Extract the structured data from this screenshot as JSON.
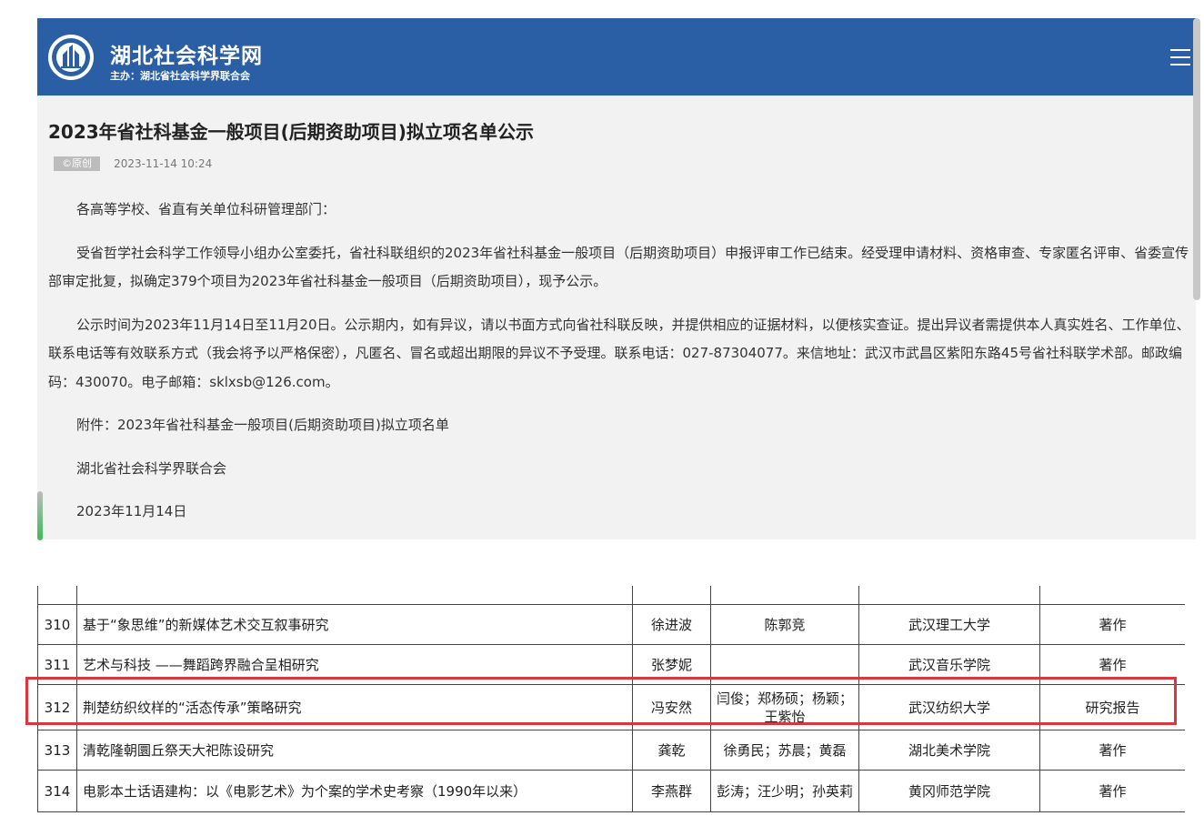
{
  "header": {
    "site_name": "湖北社会科学网",
    "sponsor": "主办：湖北省社会科学界联合会",
    "logo_icon": "emblem-logo-icon",
    "menu_icon": "hamburger-menu-icon",
    "bg_color": "#2a5fa6"
  },
  "article": {
    "title": "2023年省社科基金一般项目(后期资助项目)拟立项名单公示",
    "badge": "©原创",
    "date": "2023-11-14 10:24",
    "paragraphs": [
      "各高等学校、省直有关单位科研管理部门：",
      "受省哲学社会科学工作领导小组办公室委托，省社科联组织的2023年省社科基金一般项目（后期资助项目）申报评审工作已结束。经受理申请材料、资格审查、专家匿名评审、省委宣传部审定批复，拟确定379个项目为2023年省社科基金一般项目（后期资助项目），现予公示。",
      "公示时间为2023年11月14日至11月20日。公示期内，如有异议，请以书面方式向省社科联反映，并提供相应的证据材料，以便核实查证。提出异议者需提供本人真实姓名、工作单位、联系电话等有效联系方式（我会将予以严格保密），凡匿名、冒名或超出期限的异议不予受理。联系电话：027-87304077。来信地址：武汉市武昌区紫阳东路45号省社科联学术部。邮政编码：430070。电子邮箱：sklxsb@126.com。",
      "附件：2023年省社科基金一般项目(后期资助项目)拟立项名单",
      "湖北省社会科学界联合会",
      "2023年11月14日"
    ]
  },
  "table": {
    "rows": [
      {
        "no": "310",
        "title": "基于“象思维”的新媒体艺术交互叙事研究",
        "leader": "徐进波",
        "members": "陈郭竞",
        "unit": "武汉理工大学",
        "type": "著作"
      },
      {
        "no": "311",
        "title": "艺术与科技 ——舞蹈跨界融合呈相研究",
        "leader": "张梦妮",
        "members": "",
        "unit": "武汉音乐学院",
        "type": "著作"
      },
      {
        "no": "312",
        "title": "荆楚纺织纹样的“活态传承”策略研究",
        "leader": "冯安然",
        "members": "闫俊；郑杨硕；杨颖；王紫怡",
        "unit": "武汉纺织大学",
        "type": "研究报告"
      },
      {
        "no": "313",
        "title": "清乾隆朝圜丘祭天大祀陈设研究",
        "leader": "龚乾",
        "members": "徐勇民；苏晨；黄磊",
        "unit": "湖北美术学院",
        "type": "著作"
      },
      {
        "no": "314",
        "title": "电影本土话语建构：以《电影艺术》为个案的学术史考察（1990年以来）",
        "leader": "李燕群",
        "members": "彭涛；汪少明；孙英莉",
        "unit": "黄冈师范学院",
        "type": "著作"
      }
    ],
    "highlight_color": "#d9363e"
  }
}
